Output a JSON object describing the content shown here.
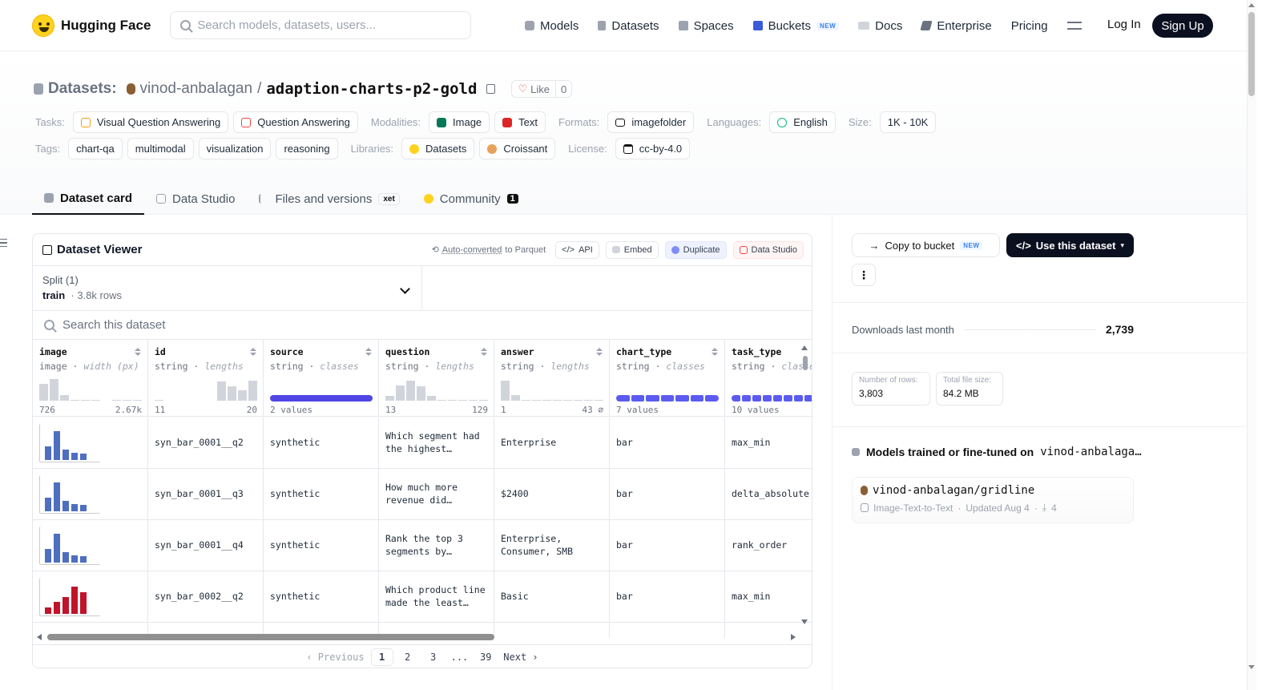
{
  "nav": {
    "brand": "Hugging Face",
    "search_placeholder": "Search models, datasets, users...",
    "links": [
      {
        "label": "Models",
        "icon": "models-icon",
        "color": "#9ca3af"
      },
      {
        "label": "Datasets",
        "icon": "datasets-icon",
        "color": "#9ca3af"
      },
      {
        "label": "Spaces",
        "icon": "spaces-icon",
        "color": "#9ca3af"
      },
      {
        "label": "Buckets",
        "icon": "buckets-icon",
        "color": "#3b5bdb",
        "badge": "NEW"
      },
      {
        "label": "Docs",
        "icon": "docs-icon",
        "color": "#9ca3af"
      },
      {
        "label": "Enterprise",
        "icon": "enterprise-icon",
        "color": "#6b7280"
      },
      {
        "label": "Pricing"
      }
    ],
    "login": "Log In",
    "signup": "Sign Up"
  },
  "header": {
    "section": "Datasets:",
    "owner": "vinod-anbalagan",
    "separator": "/",
    "name": "adaption-charts-p2-gold",
    "like_label": "Like",
    "like_count": "0",
    "tasks_label": "Tasks:",
    "tasks": [
      "Visual Question Answering",
      "Question Answering"
    ],
    "modalities_label": "Modalities:",
    "modalities": [
      "Image",
      "Text"
    ],
    "formats_label": "Formats:",
    "formats": [
      "imagefolder"
    ],
    "languages_label": "Languages:",
    "languages": [
      "English"
    ],
    "size_label": "Size:",
    "size": "1K - 10K",
    "tags_label": "Tags:",
    "tags": [
      "chart-qa",
      "multimodal",
      "visualization",
      "reasoning"
    ],
    "libraries_label": "Libraries:",
    "libraries": [
      "Datasets",
      "Croissant"
    ],
    "license_label": "License:",
    "license": "cc-by-4.0"
  },
  "tabs": [
    {
      "label": "Dataset card",
      "active": true
    },
    {
      "label": "Data Studio"
    },
    {
      "label": "Files and versions",
      "badge": "xet"
    },
    {
      "label": "Community",
      "count": "1"
    }
  ],
  "viewer": {
    "title": "Dataset Viewer",
    "auto_converted": "Auto-converted",
    "to_parquet": "to Parquet",
    "api": "API",
    "embed": "Embed",
    "duplicate": "Duplicate",
    "data_studio": "Data Studio",
    "split_label": "Split (1)",
    "split_name": "train",
    "split_rows": "3.8k rows",
    "search_placeholder": "Search this dataset",
    "columns": [
      {
        "name": "image",
        "type": "image",
        "stat": "width (px)",
        "min": "726",
        "max": "2.67k",
        "kind": "hist",
        "hist": [
          0.7,
          0.9,
          0.25,
          0.05,
          0.05,
          0.05,
          0,
          0.05,
          0.05,
          0.05
        ]
      },
      {
        "name": "id",
        "type": "string",
        "stat": "lengths",
        "min": "11",
        "max": "20",
        "kind": "hist",
        "hist": [
          0.05,
          0,
          0,
          0,
          0,
          0,
          0.8,
          0.6,
          0.45,
          0.85
        ]
      },
      {
        "name": "source",
        "type": "string",
        "stat": "classes",
        "values": "2 values",
        "kind": "cat",
        "segments": 1
      },
      {
        "name": "question",
        "type": "string",
        "stat": "lengths",
        "min": "13",
        "max": "129",
        "kind": "hist",
        "hist": [
          0.2,
          0.65,
          0.85,
          0.6,
          0.2,
          0.05,
          0.05,
          0.05,
          0.05,
          0.05
        ]
      },
      {
        "name": "answer",
        "type": "string",
        "stat": "lengths",
        "min": "1",
        "max": "43 ⌀",
        "kind": "hist",
        "hist": [
          0.85,
          0.25,
          0.05,
          0.05,
          0.05,
          0.05,
          0.05,
          0.05,
          0.05,
          0.05
        ]
      },
      {
        "name": "chart_type",
        "type": "string",
        "stat": "classes",
        "values": "7 values",
        "kind": "cat",
        "segments": 7
      },
      {
        "name": "task_type",
        "type": "string",
        "stat": "classes",
        "values": "10 values",
        "kind": "cat",
        "segments": 10
      }
    ],
    "rows": [
      {
        "id": "syn_bar_0001__q2",
        "source": "synthetic",
        "question": "Which segment had\nthe highest…",
        "answer": "Enterprise",
        "chart_type": "bar",
        "task_type": "max_min",
        "thumb": {
          "color": "#4e6fbf",
          "bars": [
            0.45,
            0.95,
            0.35,
            0.25,
            0.2
          ]
        }
      },
      {
        "id": "syn_bar_0001__q3",
        "source": "synthetic",
        "question": "How much more\nrevenue did…",
        "answer": "$2400",
        "chart_type": "bar",
        "task_type": "delta_absolute",
        "thumb": {
          "color": "#4e6fbf",
          "bars": [
            0.45,
            0.95,
            0.35,
            0.25,
            0.2
          ]
        }
      },
      {
        "id": "syn_bar_0001__q4",
        "source": "synthetic",
        "question": "Rank the top 3\nsegments by…",
        "answer": "Enterprise,\nConsumer, SMB",
        "chart_type": "bar",
        "task_type": "rank_order",
        "thumb": {
          "color": "#4e6fbf",
          "bars": [
            0.45,
            0.95,
            0.35,
            0.25,
            0.2
          ]
        }
      },
      {
        "id": "syn_bar_0002__q2",
        "source": "synthetic",
        "question": "Which product line\nmade the least…",
        "answer": "Basic",
        "chart_type": "bar",
        "task_type": "max_min",
        "thumb": {
          "color": "#c0142b",
          "bars": [
            0.2,
            0.4,
            0.55,
            0.9,
            0.7
          ]
        }
      }
    ],
    "pager": {
      "prev": "Previous",
      "pages": [
        "1",
        "2",
        "3",
        "...",
        "39"
      ],
      "next": "Next",
      "current": "1"
    }
  },
  "sidebar": {
    "copy_to_bucket": "Copy to bucket",
    "new_badge": "NEW",
    "use_dataset": "Use this dataset",
    "downloads_label": "Downloads last month",
    "downloads": "2,739",
    "rows_label": "Number of rows:",
    "rows_value": "3,803",
    "size_label": "Total file size:",
    "size_value": "84.2 MB",
    "models_title": "Models trained or fine-tuned on",
    "models_owner": "vinod-anbalaga…",
    "model_name": "vinod-anbalagan/gridline",
    "model_task": "Image-Text-to-Text",
    "model_updated": "Updated Aug 4",
    "model_downloads": "4"
  }
}
